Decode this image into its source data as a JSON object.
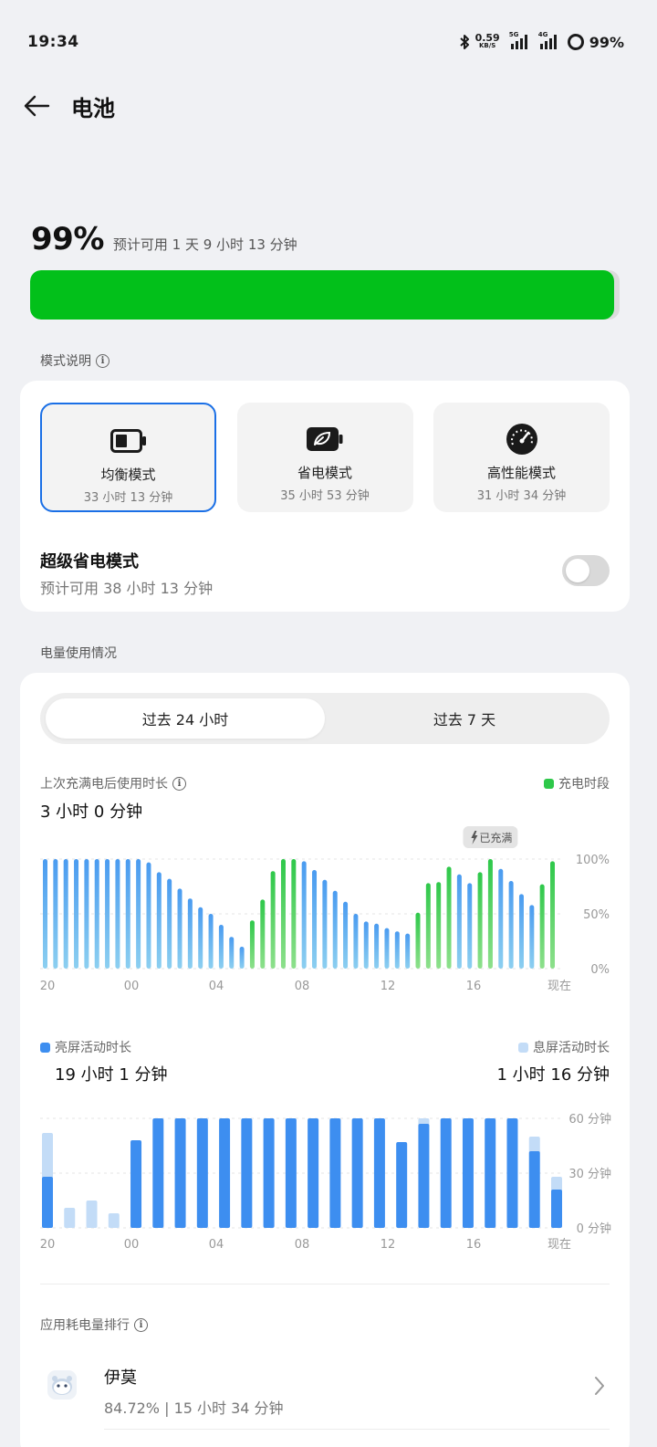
{
  "status": {
    "time": "19:34",
    "net_speed_value": "0.59",
    "net_speed_unit": "KB/S",
    "sig1_label": "5G",
    "sig2_label": "4G",
    "battery": "99%"
  },
  "header": {
    "title": "电池"
  },
  "summary": {
    "percent": "99%",
    "estimate": "预计可用 1 天 9 小时 13 分钟",
    "level": 0.99,
    "color": "#02c01a"
  },
  "modes": {
    "section_title": "模式说明",
    "items": [
      {
        "name": "均衡模式",
        "time": "33 小时 13 分钟",
        "icon": "battery-icon",
        "selected": true
      },
      {
        "name": "省电模式",
        "time": "35 小时 53 分钟",
        "icon": "leaf-battery-icon",
        "selected": false
      },
      {
        "name": "高性能模式",
        "time": "31 小时 34 分钟",
        "icon": "speedometer-icon",
        "selected": false
      }
    ],
    "super_title": "超级省电模式",
    "super_sub": "预计可用 38 小时 13 分钟",
    "super_enabled": false
  },
  "usage": {
    "section_title": "电量使用情况",
    "tabs": [
      "过去 24 小时",
      "过去 7 天"
    ],
    "active_tab": 0,
    "since_label": "上次充满电后使用时长",
    "since_value": "3 小时 0 分钟",
    "charging_legend": "充电时段",
    "full_tag": "已充满",
    "screen_on_label": "亮屏活动时长",
    "screen_on_value": "19 小时 1 分钟",
    "screen_off_label": "息屏活动时长",
    "screen_off_value": "1 小时 16 分钟",
    "ranking_title": "应用耗电量排行"
  },
  "apps": [
    {
      "name": "伊莫",
      "stat": "84.72% | 15 小时 34 分钟"
    }
  ],
  "chart_data": [
    {
      "type": "bar",
      "name": "battery-level",
      "x_ticks": [
        "20",
        "00",
        "04",
        "08",
        "12",
        "16",
        "现在"
      ],
      "y_ticks": [
        "100%",
        "50%",
        "0%"
      ],
      "ylim": [
        0,
        100
      ],
      "values": [
        100,
        100,
        100,
        100,
        100,
        100,
        100,
        100,
        100,
        100,
        97,
        88,
        82,
        73,
        64,
        56,
        50,
        40,
        29,
        20,
        44,
        63,
        89,
        100,
        100,
        98,
        90,
        81,
        71,
        61,
        50,
        43,
        41,
        37,
        34,
        32,
        51,
        78,
        79,
        93,
        86,
        78,
        88,
        100,
        91,
        80,
        68,
        58,
        77,
        98
      ],
      "charging": [
        0,
        0,
        0,
        0,
        0,
        0,
        0,
        0,
        0,
        0,
        0,
        0,
        0,
        0,
        0,
        0,
        0,
        0,
        0,
        0,
        1,
        1,
        1,
        1,
        1,
        0,
        0,
        0,
        0,
        0,
        0,
        0,
        0,
        0,
        0,
        0,
        1,
        1,
        1,
        1,
        0,
        0,
        1,
        1,
        0,
        0,
        0,
        0,
        1,
        1
      ],
      "full_index": 43,
      "colors": {
        "discharge_top": "#4a9bf0",
        "discharge_bottom": "#8ccff0",
        "charge_top": "#2ec84a",
        "charge_bottom": "#8ee08c"
      }
    },
    {
      "type": "bar",
      "name": "activity",
      "x_ticks": [
        "20",
        "00",
        "04",
        "08",
        "12",
        "16",
        "现在"
      ],
      "y_ticks": [
        "60 分钟",
        "30 分钟",
        "0 分钟"
      ],
      "ylim": [
        0,
        60
      ],
      "series": [
        {
          "name": "亮屏活动时长",
          "color": "#3d8ef0",
          "values": [
            28,
            0,
            0,
            0,
            48,
            60,
            60,
            60,
            60,
            60,
            60,
            60,
            60,
            60,
            60,
            60,
            47,
            57,
            60,
            60,
            60,
            60,
            42,
            21
          ]
        },
        {
          "name": "息屏活动时长",
          "color": "#c3dcf7",
          "values": [
            24,
            11,
            15,
            8,
            0,
            0,
            0,
            0,
            0,
            0,
            0,
            0,
            0,
            0,
            0,
            0,
            0,
            3,
            0,
            0,
            0,
            0,
            8,
            7
          ]
        }
      ]
    }
  ]
}
